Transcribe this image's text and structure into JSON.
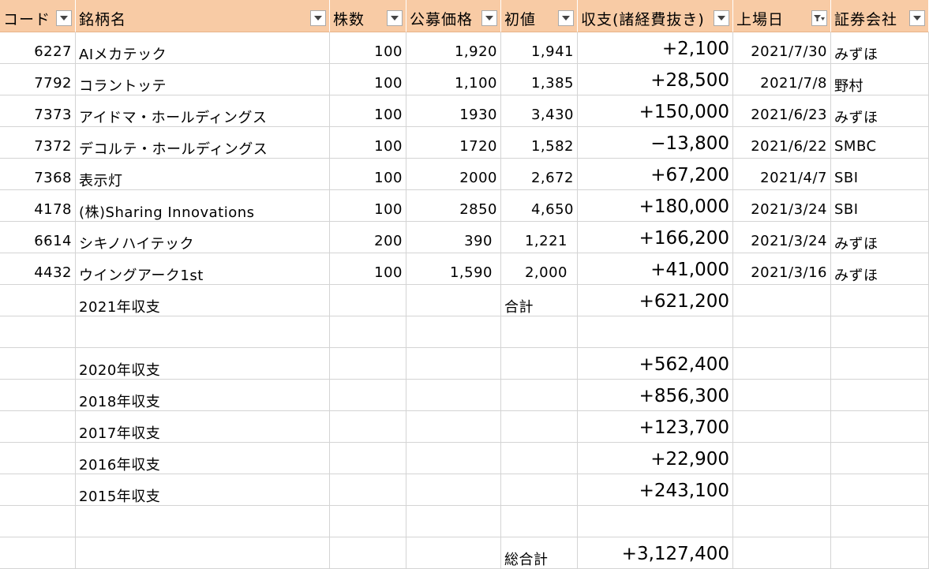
{
  "headers": {
    "code": "コード",
    "name": "銘柄名",
    "shares": "株数",
    "offer_price": "公募価格",
    "first_price": "初値",
    "profit": "収支(諸経費抜き)",
    "listing_date": "上場日",
    "broker": "証券会社"
  },
  "icons": {
    "filter": "dropdown-arrow-icon",
    "active_filter": "filter-active-icon"
  },
  "rows": [
    {
      "code": "6227",
      "name": "AIメカテック",
      "shares": "100",
      "offer": "1,920",
      "first": "1,941",
      "profit": "+2,100",
      "date": "2021/7/30",
      "broker": "みずほ"
    },
    {
      "code": "7792",
      "name": "コラントッテ",
      "shares": "100",
      "offer": "1,100",
      "first": "1,385",
      "profit": "+28,500",
      "date": "2021/7/8",
      "broker": "野村"
    },
    {
      "code": "7373",
      "name": "アイドマ・ホールディングス",
      "shares": "100",
      "offer": "1930",
      "first": "3,430",
      "profit": "+150,000",
      "date": "2021/6/23",
      "broker": "みずほ"
    },
    {
      "code": "7372",
      "name": "デコルテ・ホールディングス",
      "shares": "100",
      "offer": "1720",
      "first": "1,582",
      "profit": "−13,800",
      "date": "2021/6/22",
      "broker": "SMBC"
    },
    {
      "code": "7368",
      "name": "表示灯",
      "shares": "100",
      "offer": "2000",
      "first": "2,672",
      "profit": "+67,200",
      "date": "2021/4/7",
      "broker": "SBI"
    },
    {
      "code": "4178",
      "name": "(株)Sharing Innovations",
      "shares": "100",
      "offer": "2850",
      "first": "4,650",
      "profit": "+180,000",
      "date": "2021/3/24",
      "broker": "SBI"
    },
    {
      "code": "6614",
      "name": "シキノハイテック",
      "shares": "200",
      "offer": "390",
      "first": "1,221",
      "profit": "+166,200",
      "date": "2021/3/24",
      "broker": "みずほ"
    },
    {
      "code": "4432",
      "name": "ウイングアーク1st",
      "shares": "100",
      "offer": "1,590",
      "first": "2,000",
      "profit": "+41,000",
      "date": "2021/3/16",
      "broker": "みずほ"
    }
  ],
  "summary_2021": {
    "label": "2021年収支",
    "total_label": "合計",
    "value": "+621,200"
  },
  "yearly": [
    {
      "label": "2020年収支",
      "value": "+562,400"
    },
    {
      "label": "2018年収支",
      "value": "+856,300"
    },
    {
      "label": "2017年収支",
      "value": "+123,700"
    },
    {
      "label": "2016年収支",
      "value": "+22,900"
    },
    {
      "label": "2015年収支",
      "value": "+243,100"
    }
  ],
  "grand_total": {
    "label": "総合計",
    "value": "+3,127,400"
  }
}
